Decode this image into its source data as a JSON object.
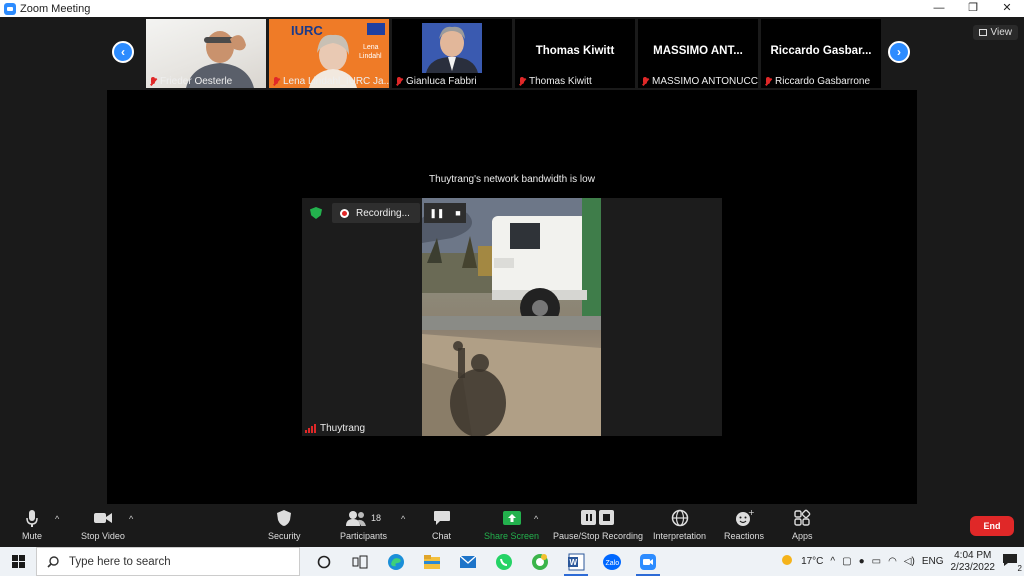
{
  "window": {
    "title": "Zoom Meeting",
    "minimize": "—",
    "restore": "❐",
    "close": "✕"
  },
  "view_button": {
    "label": "View"
  },
  "nav": {
    "prev": "‹",
    "next": "›"
  },
  "participants_strip": [
    {
      "name": "Frieder Oesterle",
      "big_name": ""
    },
    {
      "name": "Lena Lindahl_IURC Ja...",
      "big_name": "",
      "overlay_brand": "IURC",
      "overlay_name": "Lena\nLindahl"
    },
    {
      "name": "Gianluca Fabbri",
      "big_name": ""
    },
    {
      "name": "Thomas Kiwitt",
      "big_name": "Thomas Kiwitt"
    },
    {
      "name": "MASSIMO ANTONUCCI",
      "big_name": "MASSIMO ANT..."
    },
    {
      "name": "Riccardo Gasbarrone",
      "big_name": "Riccardo Gasbar..."
    }
  ],
  "stage": {
    "bandwidth_notice": "Thuytrang's network bandwidth is low",
    "recording_label": "Recording...",
    "active_speaker": "Thuytrang"
  },
  "toolbar": {
    "mute": "Mute",
    "stop_video": "Stop Video",
    "security": "Security",
    "participants": "Participants",
    "participants_count": "18",
    "chat": "Chat",
    "share_screen": "Share Screen",
    "pause_stop_recording": "Pause/Stop Recording",
    "interpretation": "Interpretation",
    "reactions": "Reactions",
    "apps": "Apps",
    "end": "End"
  },
  "taskbar": {
    "search_placeholder": "Type here to search",
    "weather": "17°C",
    "language": "ENG",
    "time": "4:04 PM",
    "date": "2/23/2022",
    "notification_count": "2"
  },
  "colors": {
    "accent": "#2d8cff",
    "end": "#e02828",
    "share": "#23b14d",
    "muted": "#e02828"
  }
}
